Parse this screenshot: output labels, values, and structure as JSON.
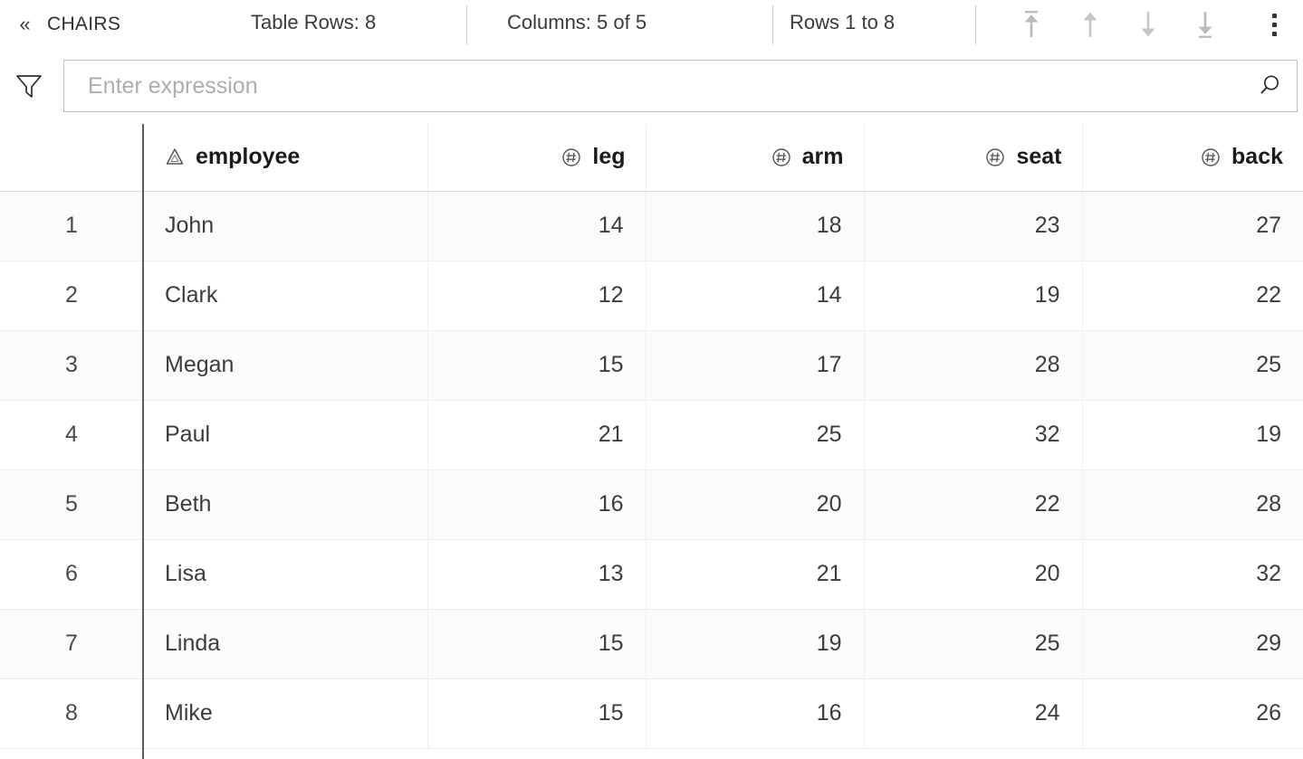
{
  "toolbar": {
    "collapse_label": "«",
    "collapse_icon": "chevron-double-left-icon",
    "table_name": "CHAIRS",
    "table_rows": "Table Rows: 8",
    "columns": "Columns: 5 of 5",
    "row_range": "Rows 1 to 8",
    "nav": [
      {
        "name": "first-page-icon",
        "title": "Go to first rows"
      },
      {
        "name": "previous-page-icon",
        "title": "Previous rows"
      },
      {
        "name": "next-page-icon",
        "title": "Next rows"
      },
      {
        "name": "last-page-icon",
        "title": "Go to last rows"
      }
    ],
    "menu_icon": "kebab-menu-icon"
  },
  "filter": {
    "funnel_icon": "filter-funnel-icon",
    "placeholder": "Enter expression",
    "value": "",
    "search_icon": "search-icon"
  },
  "table": {
    "index_header": "",
    "columns": [
      {
        "label": "employee",
        "type_icon": "string-type-icon",
        "align": "left"
      },
      {
        "label": "leg",
        "type_icon": "number-type-icon",
        "align": "right"
      },
      {
        "label": "arm",
        "type_icon": "number-type-icon",
        "align": "right"
      },
      {
        "label": "seat",
        "type_icon": "number-type-icon",
        "align": "right"
      },
      {
        "label": "back",
        "type_icon": "number-type-icon",
        "align": "right"
      }
    ],
    "rows": [
      {
        "index": "1",
        "employee": "John",
        "leg": "14",
        "arm": "18",
        "seat": "23",
        "back": "27"
      },
      {
        "index": "2",
        "employee": "Clark",
        "leg": "12",
        "arm": "14",
        "seat": "19",
        "back": "22"
      },
      {
        "index": "3",
        "employee": "Megan",
        "leg": "15",
        "arm": "17",
        "seat": "28",
        "back": "25"
      },
      {
        "index": "4",
        "employee": "Paul",
        "leg": "21",
        "arm": "25",
        "seat": "32",
        "back": "19"
      },
      {
        "index": "5",
        "employee": "Beth",
        "leg": "16",
        "arm": "20",
        "seat": "22",
        "back": "28"
      },
      {
        "index": "6",
        "employee": "Lisa",
        "leg": "13",
        "arm": "21",
        "seat": "20",
        "back": "32"
      },
      {
        "index": "7",
        "employee": "Linda",
        "leg": "15",
        "arm": "19",
        "seat": "25",
        "back": "29"
      },
      {
        "index": "8",
        "employee": "Mike",
        "leg": "15",
        "arm": "16",
        "seat": "24",
        "back": "26"
      }
    ]
  },
  "colors": {
    "text": "#3c3c3c",
    "header_text": "#1b1b1b",
    "muted": "#adadad",
    "divider": "#c8c8c8",
    "freeze_divider": "#5b5b60",
    "row_stripe": "#fbfbfb",
    "icon_gray": "#b9b9b9"
  }
}
